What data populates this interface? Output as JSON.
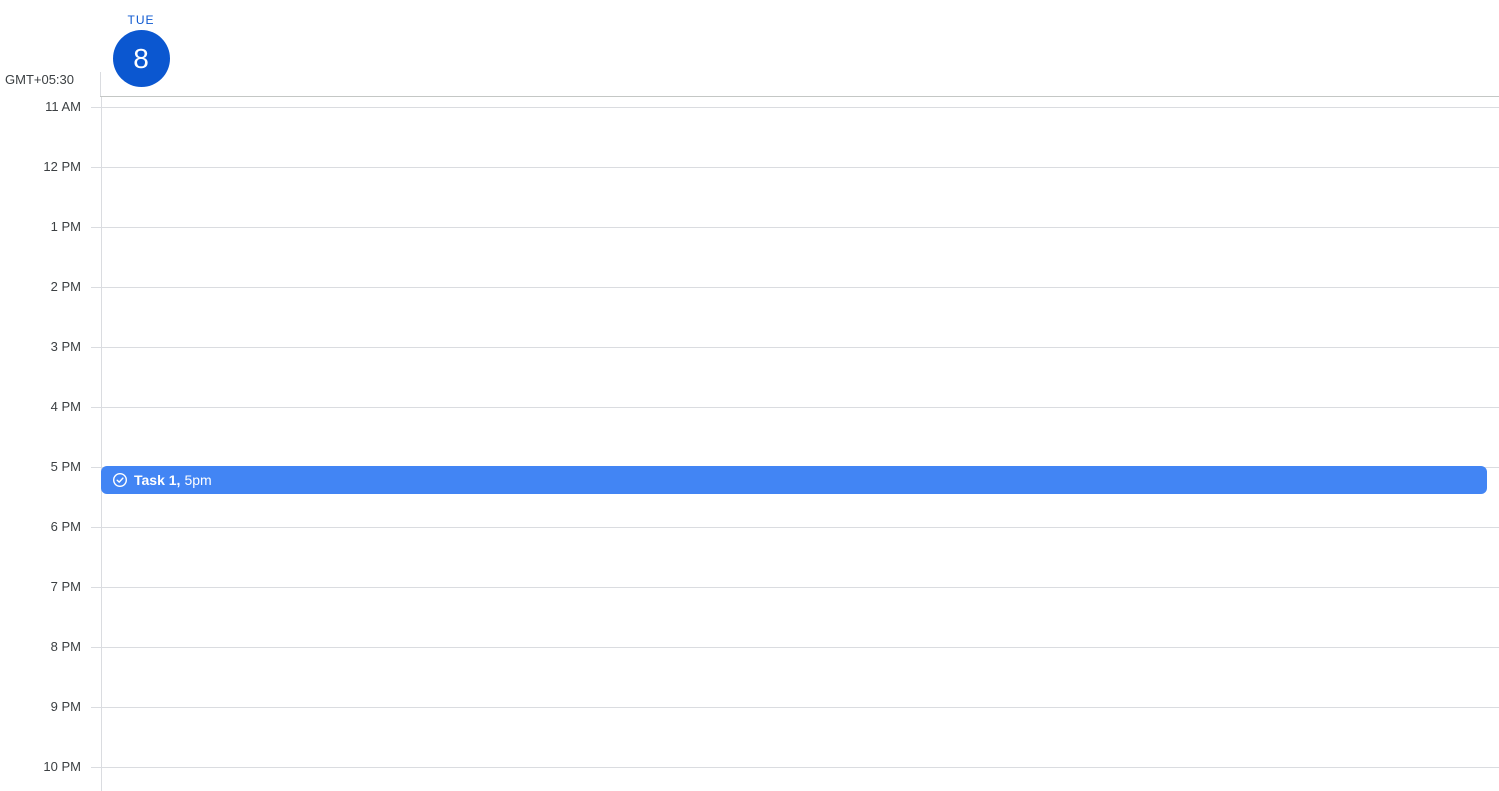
{
  "header": {
    "day_name": "TUE",
    "day_number": "8",
    "timezone": "GMT+05:30"
  },
  "hours": [
    {
      "label": "11 AM"
    },
    {
      "label": "12 PM"
    },
    {
      "label": "1 PM"
    },
    {
      "label": "2 PM"
    },
    {
      "label": "3 PM"
    },
    {
      "label": "4 PM"
    },
    {
      "label": "5 PM"
    },
    {
      "label": "6 PM"
    },
    {
      "label": "7 PM"
    },
    {
      "label": "8 PM"
    },
    {
      "label": "9 PM"
    },
    {
      "label": "10 PM"
    }
  ],
  "event": {
    "title": "Task 1,",
    "time": "5pm",
    "icon": "task-check-icon",
    "color": "#4285f4"
  },
  "colors": {
    "accent": "#0b57d0",
    "gridline": "#dadce0"
  }
}
